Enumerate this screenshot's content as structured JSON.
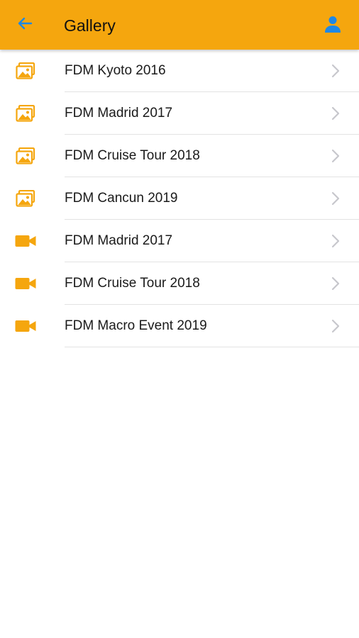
{
  "colors": {
    "app_bar": "#f5a60e",
    "accent_blue": "#1e88e5",
    "icon_orange": "#f5a60e",
    "chevron": "#c7c7cc",
    "divider": "#e3e3e3"
  },
  "header": {
    "title": "Gallery",
    "back_icon": "arrow-left-icon",
    "profile_icon": "person-icon"
  },
  "gallery": {
    "items": [
      {
        "label": "FDM Kyoto 2016",
        "icon": "photo-album-icon"
      },
      {
        "label": "FDM Madrid 2017",
        "icon": "photo-album-icon"
      },
      {
        "label": "FDM Cruise Tour 2018",
        "icon": "photo-album-icon"
      },
      {
        "label": "FDM Cancun 2019",
        "icon": "photo-album-icon"
      },
      {
        "label": "FDM Madrid 2017",
        "icon": "video-camera-icon"
      },
      {
        "label": "FDM Cruise Tour 2018",
        "icon": "video-camera-icon"
      },
      {
        "label": "FDM Macro Event 2019",
        "icon": "video-camera-icon"
      }
    ]
  }
}
